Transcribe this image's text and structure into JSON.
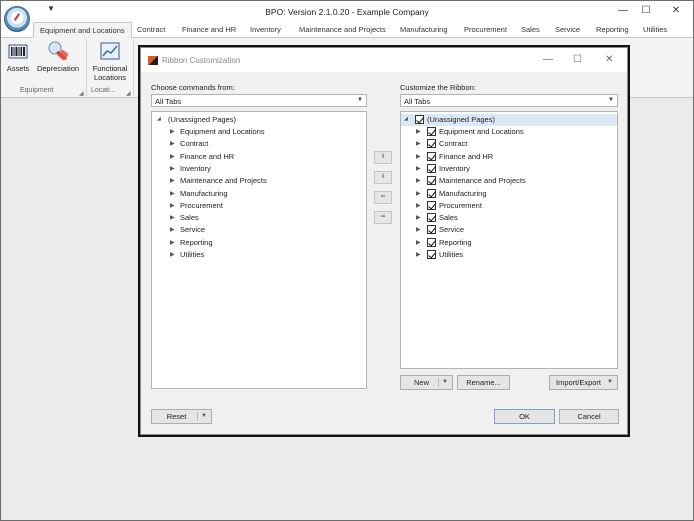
{
  "app": {
    "title": "BPO: Version 2.1.0.20 - Example Company",
    "quick_access_arrow": "▼",
    "window_controls": {
      "minimize": "—",
      "maximize": "☐",
      "close": "✕"
    }
  },
  "ribbon": {
    "tabs": [
      {
        "label": "Equipment and Locations",
        "active": true
      },
      {
        "label": "Contract"
      },
      {
        "label": "Finance and HR"
      },
      {
        "label": "Inventory"
      },
      {
        "label": "Maintenance and Projects"
      },
      {
        "label": "Manufacturing"
      },
      {
        "label": "Procurement"
      },
      {
        "label": "Sales"
      },
      {
        "label": "Service"
      },
      {
        "label": "Reporting"
      },
      {
        "label": "Utilities"
      }
    ],
    "buttons": {
      "assets": "Assets",
      "depreciation": "Depreciation",
      "functional_locations_1": "Functional",
      "functional_locations_2": "Locations"
    },
    "groups": {
      "equipment": "Equipment",
      "locations": "Locati..."
    }
  },
  "dialog": {
    "title": "Ribbon Customization",
    "window_controls": {
      "minimize": "—",
      "maximize": "☐",
      "close": "✕"
    },
    "left": {
      "label": "Choose commands from:",
      "combo_value": "All Tabs",
      "root": "(Unassigned Pages)",
      "items": [
        "Equipment and Locations",
        "Contract",
        "Finance and HR",
        "Inventory",
        "Maintenance and Projects",
        "Manufacturing",
        "Procurement",
        "Sales",
        "Service",
        "Reporting",
        "Utilities"
      ]
    },
    "right": {
      "label": "Customize the Ribbon:",
      "combo_value": "All Tabs",
      "root": "(Unassigned Pages)",
      "items": [
        "Equipment and Locations",
        "Contract",
        "Finance and HR",
        "Inventory",
        "Maintenance and Projects",
        "Manufacturing",
        "Procurement",
        "Sales",
        "Service",
        "Reporting",
        "Utilities"
      ]
    },
    "arrow_buttons": {
      "up": "⬆",
      "down": "⬇",
      "left": "⬅",
      "right": "➡"
    },
    "buttons": {
      "new": "New",
      "rename": "Rename...",
      "import_export": "Import/Export",
      "reset": "Reset",
      "ok": "OK",
      "cancel": "Cancel"
    },
    "glyphs": {
      "expand": "▶",
      "collapse": "◢",
      "dropdown": "▼"
    }
  },
  "colors": {
    "selection": "#dbe9f7",
    "dialog_logo_orange": "#e05a1e"
  }
}
